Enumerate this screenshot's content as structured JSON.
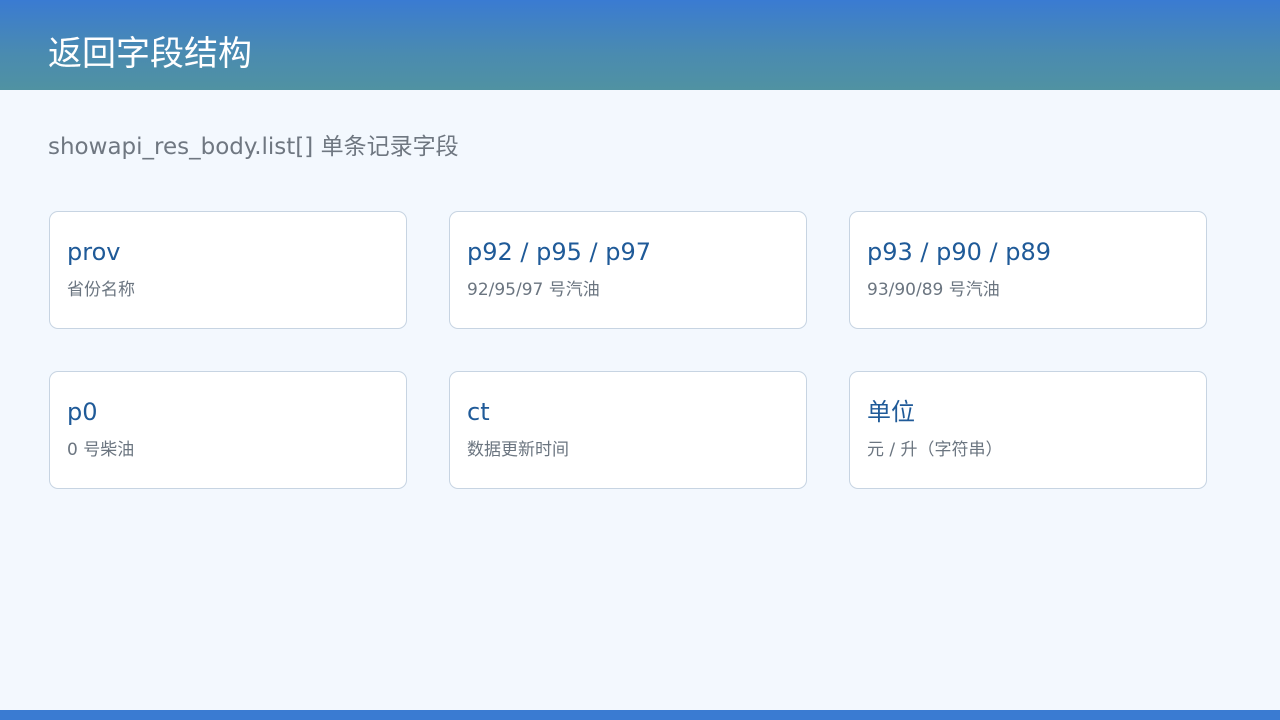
{
  "header": {
    "title": "返回字段结构"
  },
  "subtitle": "showapi_res_body.list[] 单条记录字段",
  "fields": [
    {
      "name": "prov",
      "description": "省份名称"
    },
    {
      "name": "p92 / p95 / p97",
      "description": "92/95/97 号汽油"
    },
    {
      "name": "p93 / p90 / p89",
      "description": "93/90/89 号汽油"
    },
    {
      "name": "p0",
      "description": "0 号柴油"
    },
    {
      "name": "ct",
      "description": "数据更新时间"
    },
    {
      "name": "单位",
      "description": "元 / 升（字符串）"
    }
  ],
  "colors": {
    "header_start": "#3a7bd2",
    "header_end": "#5092a2",
    "background": "#f3f8fe",
    "card_title": "#1f5a98",
    "card_border": "#c7d4e2",
    "footer_bar": "#3a7bd2"
  }
}
